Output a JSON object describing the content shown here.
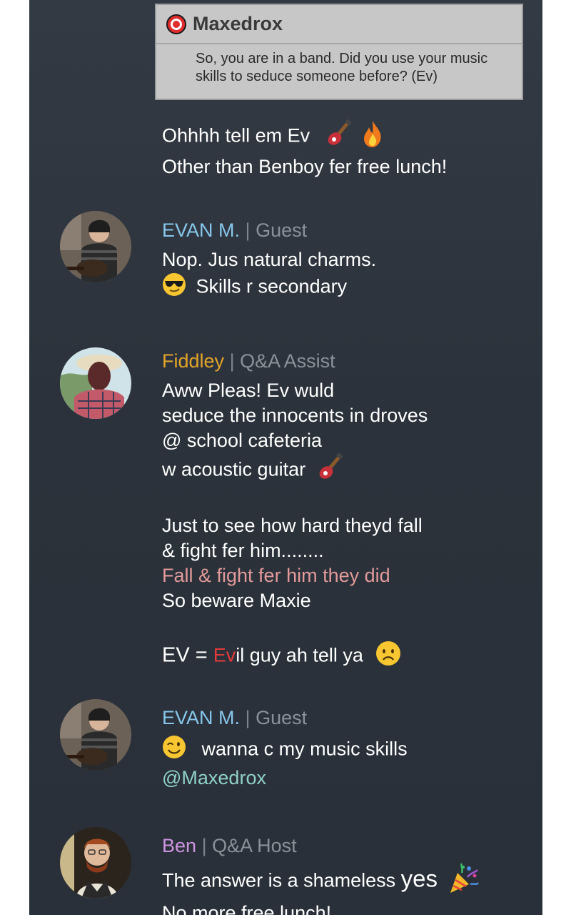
{
  "question": {
    "author": "Maxedrox",
    "text_line1": "So, you are in a band. Did you use your music",
    "text_line2": "skills to seduce someone before? (Ev)"
  },
  "messages": [
    {
      "lines": [
        "Ohhhh tell em Ev",
        "Other than Benboy fer free lunch!"
      ],
      "emojis": [
        "guitar-icon",
        "fire-icon"
      ]
    },
    {
      "name": "EVAN M.",
      "sep": "|",
      "role": "Guest",
      "lines": [
        "Nop. Jus natural charms.",
        "Skills r secondary"
      ],
      "emojis": [
        "sunglasses-face-icon"
      ]
    },
    {
      "name": "Fiddley",
      "sep": "|",
      "role": "Q&A Assist",
      "lines": [
        "Aww Pleas! Ev wuld",
        "seduce the innocents in droves",
        "@ school cafeteria",
        "w acoustic guitar",
        "Just to see how hard theyd fall",
        "& fight fer him........",
        "Fall & fight fer him they did",
        "So beware Maxie"
      ],
      "ev_line": {
        "prefix": "EV = ",
        "highlight": "Ev",
        "rest": "il guy ah tell ya"
      },
      "emojis": [
        "guitar-icon",
        "frowning-face-icon"
      ]
    },
    {
      "name": "EVAN M.",
      "sep": "|",
      "role": "Guest",
      "lines": [
        "wanna c my music skills",
        "@Maxedrox"
      ],
      "emojis": [
        "winking-face-icon"
      ]
    },
    {
      "name": "Ben",
      "sep": "|",
      "role": "Q&A Host",
      "line1_prefix": "The answer is a shameless ",
      "line1_big": "yes",
      "line2": "No more free lunch!",
      "emojis": [
        "party-popper-icon"
      ]
    }
  ],
  "colors": {
    "evan_name": "#87c6ea",
    "fiddley_name": "#e3a52a",
    "ben_name": "#cc95e0",
    "role": "#8a9199",
    "pink_text": "#e29a9a",
    "ev_highlight": "#e23a3a",
    "mention": "#8fd0c6",
    "panel_bg": "#2f353e"
  }
}
